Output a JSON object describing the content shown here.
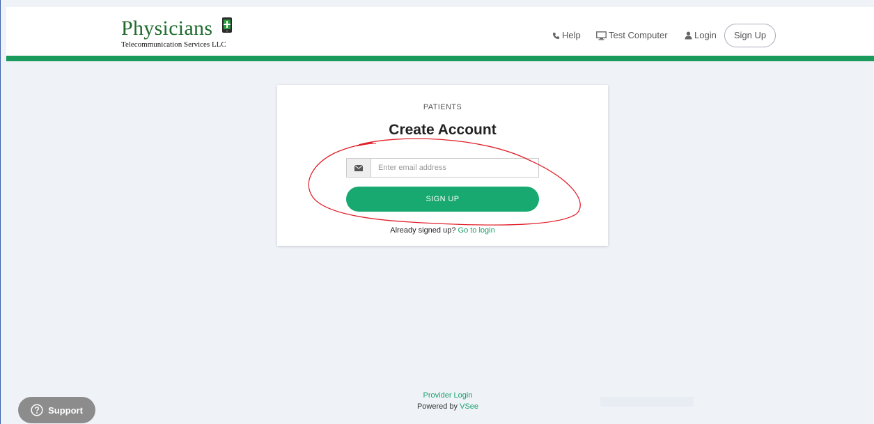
{
  "brand": {
    "title": "Physicians",
    "subtitle": "Telecommunication Services LLC",
    "icon": "phone-plus-icon"
  },
  "nav": {
    "help": "Help",
    "test_computer": "Test Computer",
    "login": "Login",
    "sign_up": "Sign Up"
  },
  "card": {
    "eyebrow": "PATIENTS",
    "title": "Create Account",
    "email_placeholder": "Enter email address",
    "email_value": "",
    "submit_label": "SIGN UP",
    "already_text": "Already signed up?",
    "login_link": "Go to login"
  },
  "footer": {
    "provider_login": "Provider Login",
    "powered_by": "Powered by",
    "vendor": "VSee"
  },
  "support": {
    "label": "Support"
  },
  "colors": {
    "brand_green": "#1a9a5c",
    "button_green": "#17a96f",
    "annotation_red": "#e0202a"
  }
}
